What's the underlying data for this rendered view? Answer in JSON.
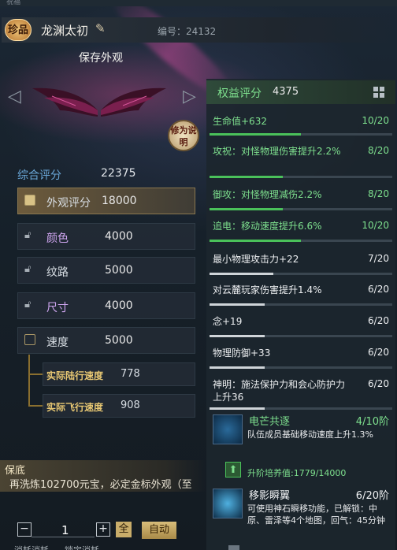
{
  "header": {
    "top_tab": "祝福",
    "rarity_badge": "珍品",
    "name": "龙渊太初",
    "serial": "编号：24132",
    "save_label": "保存外观",
    "repair_label": "修为说明"
  },
  "summary": {
    "label": "综合评分",
    "value": "22375"
  },
  "attributes": [
    {
      "label": "外观评分",
      "value": "18000"
    },
    {
      "label": "颜色",
      "value": "4000"
    },
    {
      "label": "纹路",
      "value": "5000"
    },
    {
      "label": "尺寸",
      "value": "4000"
    },
    {
      "label": "速度",
      "value": "5000"
    }
  ],
  "speeds": [
    {
      "label": "实际陆行速度",
      "value": "778"
    },
    {
      "label": "实际飞行速度",
      "value": "908"
    }
  ],
  "guarantee": {
    "title": "保底",
    "text": "再洗炼102700元宝，必定金标外观（至"
  },
  "controls": {
    "minus": "−",
    "qty": "1",
    "plus": "+",
    "all": "全",
    "auto": "自动",
    "footer_left": "消耗消耗",
    "footer_right": "锁定消耗"
  },
  "panel": {
    "title": "权益评分",
    "score": "4375"
  },
  "stats": [
    {
      "name": "生命值+632",
      "count": "10/20",
      "level": 0.5,
      "tone": "green"
    },
    {
      "name": "攻祝：对怪物理伤害提升2.2%",
      "count": "8/20",
      "level": 0.4,
      "tone": "green"
    },
    {
      "name": "御攻：对怪物理减伤2.2%",
      "count": "8/20",
      "level": 0.4,
      "tone": "green"
    },
    {
      "name": "追电：移动速度提升6.6%",
      "count": "10/20",
      "level": 0.5,
      "tone": "green"
    },
    {
      "name": "最小物理攻击力+22",
      "count": "7/20",
      "level": 0.35,
      "tone": "white"
    },
    {
      "name": "对云麓玩家伤害提升1.4%",
      "count": "6/20",
      "level": 0.3,
      "tone": "white"
    },
    {
      "name": "念+19",
      "count": "6/20",
      "level": 0.3,
      "tone": "white"
    },
    {
      "name": "物理防御+33",
      "count": "6/20",
      "level": 0.3,
      "tone": "white"
    },
    {
      "name": "神明：施法保护力和会心防护力上升36",
      "count": "6/20",
      "level": 0.3,
      "tone": "white"
    }
  ],
  "skills": [
    {
      "title": "电芒共逐",
      "count": "4/10阶",
      "desc": "队伍成员基础移动速度上升1.3%",
      "tone": "green"
    },
    {
      "title": "移影瞬翼",
      "count": "6/20阶",
      "desc": "可使用神石瞬移功能，已解锁：中原、雷泽等4个地图，回气：45分钟",
      "tone": "white"
    }
  ],
  "upgrade": {
    "text": "升阶培养值:1779/14000"
  }
}
